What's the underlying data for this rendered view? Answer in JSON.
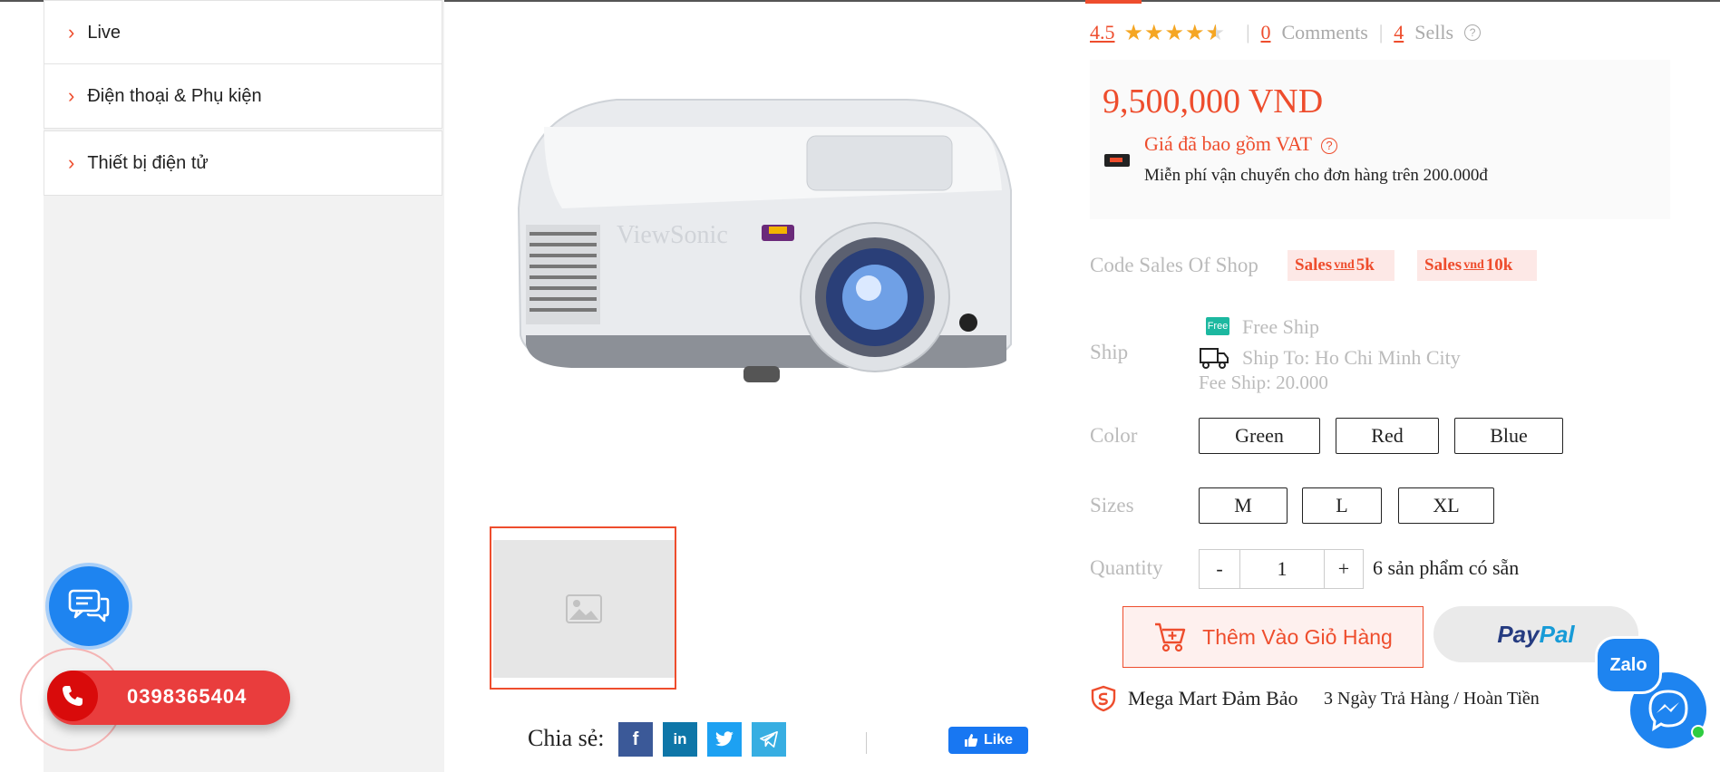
{
  "sidebar": {
    "categories": [
      {
        "label": "Live"
      },
      {
        "label": "Điện thoại & Phụ kiện"
      },
      {
        "label": "Thiết bị điện tử"
      }
    ]
  },
  "product": {
    "rating": "4.5",
    "rating_stars": 4.5,
    "comments_count": "0",
    "comments_label": "Comments",
    "sells_count": "4",
    "sells_label": "Sells",
    "image_brand": "ViewSonic",
    "price": "9,500,000 VND",
    "vat_note": "Giá đã bao gồm VAT",
    "shipping_note": "Miễn phí vận chuyển cho đơn hàng trên 200.000đ"
  },
  "coupons": {
    "label": "Code Sales Of Shop",
    "items": [
      {
        "prefix": "Sales",
        "unit": "vnd",
        "amount": "5k"
      },
      {
        "prefix": "Sales",
        "unit": "vnd",
        "amount": "10k"
      }
    ]
  },
  "ship": {
    "label": "Ship",
    "free_tag": "Free",
    "free_ship": "Free Ship",
    "ship_to": "Ship To: Ho Chi Minh City",
    "fee": "Fee Ship: 20.000"
  },
  "color": {
    "label": "Color",
    "options": [
      "Green",
      "Red",
      "Blue"
    ]
  },
  "sizes": {
    "label": "Sizes",
    "options": [
      "M",
      "L",
      "XL"
    ]
  },
  "quantity": {
    "label": "Quantity",
    "minus": "-",
    "value": "1",
    "plus": "+",
    "available": "6 sản phẩm có sẵn"
  },
  "actions": {
    "add_to_cart": "Thêm Vào Giỏ Hàng",
    "paypal_pay": "Pay",
    "paypal_pal": "Pal"
  },
  "guarantee": {
    "title": "Mega Mart Đảm Bảo",
    "detail": "3 Ngày Trả Hàng / Hoàn Tiền"
  },
  "share": {
    "label": "Chia sẻ:",
    "facebook": "f",
    "linkedin": "in",
    "fb_like": "Like"
  },
  "contact": {
    "phone": "0398365404",
    "zalo": "Zalo"
  },
  "colors": {
    "accent": "#ee4d2d",
    "star": "#f5a623",
    "facebook": "#3b5998",
    "linkedin": "#0e76a8",
    "twitter": "#1da1f2",
    "telegram": "#37aee2",
    "chat_blue": "#1e84f0",
    "phone_red": "#e93d3d"
  }
}
